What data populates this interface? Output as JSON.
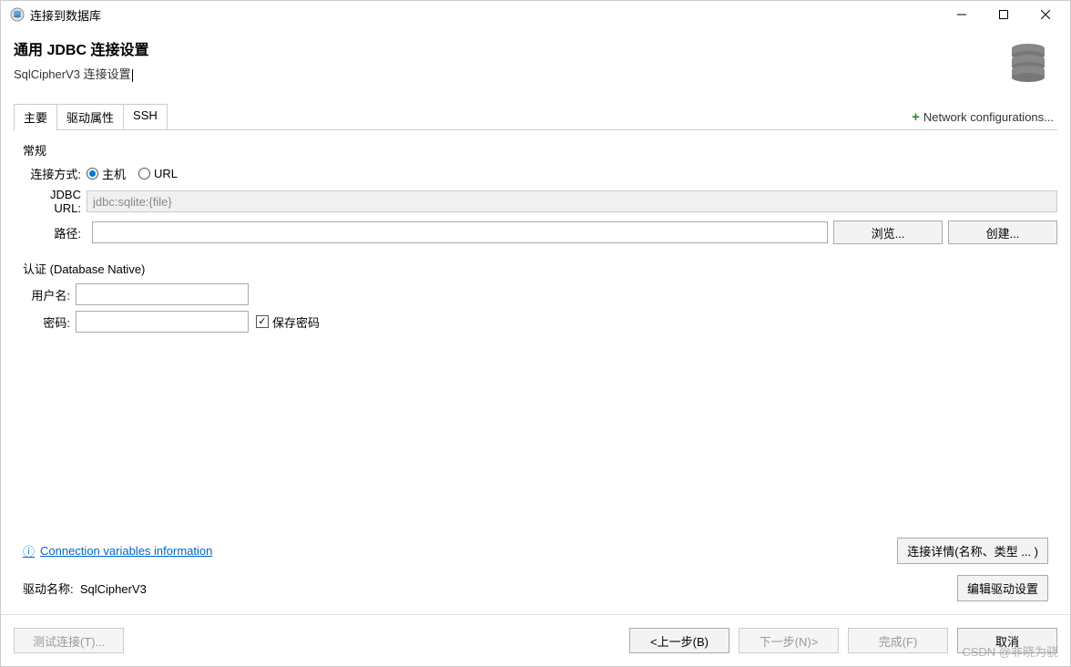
{
  "titlebar": {
    "title": "连接到数据库"
  },
  "header": {
    "title": "通用 JDBC 连接设置",
    "subtitle": "SqlCipherV3 连接设置"
  },
  "tabs": {
    "main": "主要",
    "driver_props": "驱动属性",
    "ssh": "SSH",
    "network_config": "Network configurations..."
  },
  "section_general": "常规",
  "conn_type": {
    "label": "连接方式:",
    "host": "主机",
    "url": "URL"
  },
  "jdbc_url": {
    "label": "JDBC URL:",
    "value": "jdbc:sqlite:{file}"
  },
  "path": {
    "label": "路径:",
    "value": "",
    "browse": "浏览...",
    "create": "创建..."
  },
  "auth": {
    "title": "认证 (Database Native)",
    "username_label": "用户名:",
    "username_value": "",
    "password_label": "密码:",
    "password_value": "",
    "save_password": "保存密码"
  },
  "info_link": "Connection variables information",
  "detail_btn": "连接详情(名称、类型 ... )",
  "driver": {
    "label_prefix": "驱动名称:",
    "name": "SqlCipherV3",
    "edit_btn": "编辑驱动设置"
  },
  "footer": {
    "test": "测试连接(T)...",
    "back": "<上一步(B)",
    "next": "下一步(N)>",
    "finish": "完成(F)",
    "cancel": "取消"
  },
  "watermark": "CSDN @非晓为骁"
}
